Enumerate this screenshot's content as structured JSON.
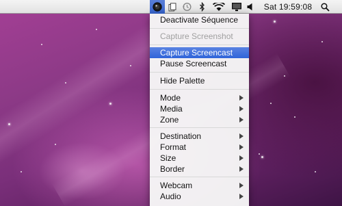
{
  "menubar": {
    "items": [
      {
        "icon": "screencast-app-icon",
        "active": true
      },
      {
        "icon": "document-copy-icon"
      },
      {
        "icon": "time-machine-icon"
      },
      {
        "icon": "bluetooth-icon"
      },
      {
        "icon": "wifi-icon"
      },
      {
        "icon": "display-icon"
      },
      {
        "icon": "volume-icon"
      },
      {
        "icon": "spotlight-search-icon"
      }
    ],
    "clock": "Sat 19:59:08",
    "accent_color": "#3663cd"
  },
  "menu": {
    "groups": [
      [
        {
          "label": "Deactivate Séquence"
        }
      ],
      [
        {
          "label": "Capture Screenshot",
          "enabled": false
        }
      ],
      [
        {
          "label": "Capture Screencast",
          "selected": true
        },
        {
          "label": "Pause Screencast"
        }
      ],
      [
        {
          "label": "Hide Palette"
        }
      ],
      [
        {
          "label": "Mode",
          "submenu": true
        },
        {
          "label": "Media",
          "submenu": true
        },
        {
          "label": "Zone",
          "submenu": true
        }
      ],
      [
        {
          "label": "Destination",
          "submenu": true
        },
        {
          "label": "Format",
          "submenu": true
        },
        {
          "label": "Size",
          "submenu": true
        },
        {
          "label": "Border",
          "submenu": true
        }
      ],
      [
        {
          "label": "Webcam",
          "submenu": true
        },
        {
          "label": "Audio",
          "submenu": true
        }
      ]
    ]
  }
}
